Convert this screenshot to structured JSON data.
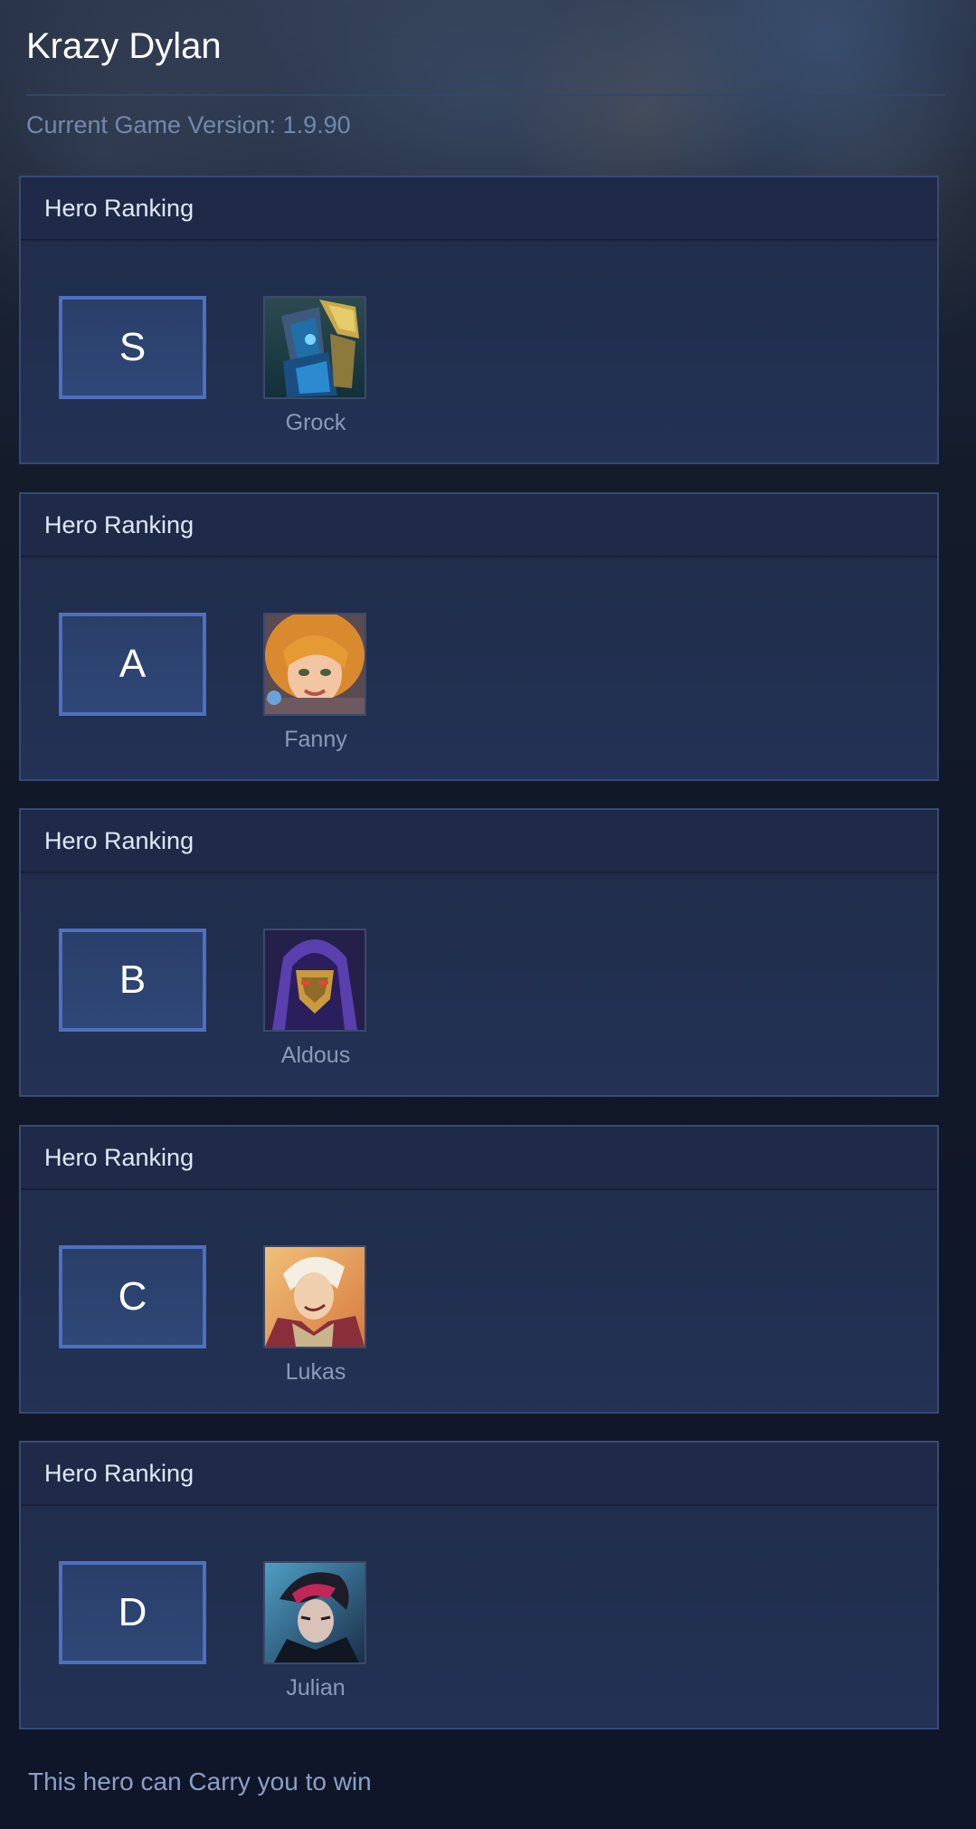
{
  "header": {
    "title": "Krazy Dylan",
    "version": "Current Game Version: 1.9.90"
  },
  "tiers": [
    {
      "card_title": "Hero Ranking",
      "tier": "S",
      "hero": {
        "name": "Grock",
        "icon": "grock-portrait"
      }
    },
    {
      "card_title": "Hero Ranking",
      "tier": "A",
      "hero": {
        "name": "Fanny",
        "icon": "fanny-portrait"
      }
    },
    {
      "card_title": "Hero Ranking",
      "tier": "B",
      "hero": {
        "name": "Aldous",
        "icon": "aldous-portrait"
      }
    },
    {
      "card_title": "Hero Ranking",
      "tier": "C",
      "hero": {
        "name": "Lukas",
        "icon": "lukas-portrait"
      }
    },
    {
      "card_title": "Hero Ranking",
      "tier": "D",
      "hero": {
        "name": "Julian",
        "icon": "julian-portrait"
      }
    }
  ],
  "footer": {
    "tagline": "This hero can Carry you to win"
  },
  "colors": {
    "tier_border": "#4d70bf",
    "card_border": "#364a73",
    "card_bg": "#233255"
  }
}
